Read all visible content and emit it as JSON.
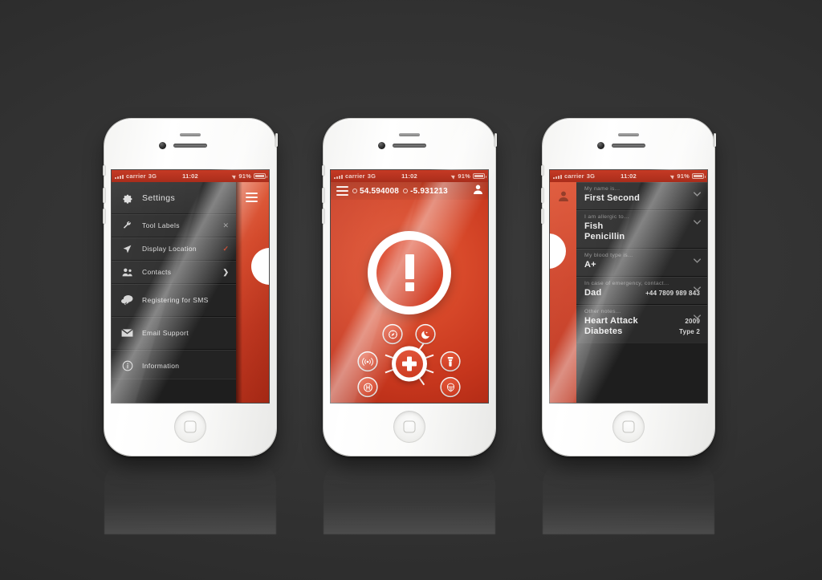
{
  "scene": {
    "background_color": "#2f2f2f",
    "device_count": 3,
    "device_color": "#ffffff",
    "accent_color": "#d3441f"
  },
  "status_bar": {
    "carrier_prefix": "..ıl",
    "carrier": "carrier",
    "network": "3G",
    "time": "11:02",
    "battery_percent": "91%",
    "signal_icon": "signal-bars-icon",
    "location_icon": "location-arrow-icon",
    "battery_icon": "battery-icon"
  },
  "phone1": {
    "name": "settings-menu-screen",
    "header": {
      "title": "Settings",
      "icon": "gear-icon"
    },
    "items": [
      {
        "label": "Tool Labels",
        "icon": "wrench-icon",
        "tail": "✕",
        "tail_name": "close-icon",
        "tail_color": "#8e8e8e"
      },
      {
        "label": "Display Location",
        "icon": "location-arrow-icon",
        "tail": "✓",
        "tail_name": "check-icon",
        "tail_color": "#c0391f"
      },
      {
        "label": "Contacts",
        "icon": "contacts-icon",
        "tail": "❯",
        "tail_name": "chevron-right-icon",
        "tail_color": "#d0d0d0"
      },
      {
        "label": "Registering for SMS",
        "icon": "chat-bubbles-icon",
        "tail": "",
        "tail_name": "",
        "tail_color": ""
      },
      {
        "label": "Email Support",
        "icon": "envelope-icon",
        "tail": "",
        "tail_name": "",
        "tail_color": ""
      },
      {
        "label": "Information",
        "icon": "info-circle-icon",
        "tail": "",
        "tail_name": "",
        "tail_color": ""
      }
    ],
    "panel": {
      "menu_icon": "hamburger-menu-icon"
    }
  },
  "phone2": {
    "name": "emergency-alert-screen",
    "toolbar": {
      "menu_icon": "hamburger-menu-icon",
      "latitude": "54.594008",
      "longitude": "-5.931213",
      "profile_icon": "person-icon"
    },
    "alert_button": {
      "label": "!",
      "icon": "exclamation-icon"
    },
    "center_button": {
      "icon": "plus-icon",
      "name": "add-tool-button"
    },
    "tools": [
      {
        "name": "compass-tool",
        "icon": "compass-icon"
      },
      {
        "name": "moon-tool",
        "icon": "moon-icon"
      },
      {
        "name": "flashlight-tool",
        "icon": "flashlight-icon"
      },
      {
        "name": "siren-tool",
        "icon": "siren-icon"
      },
      {
        "name": "hospital-tool",
        "icon": "hospital-h-icon"
      },
      {
        "name": "beacon-tool",
        "icon": "broadcast-signal-icon"
      }
    ]
  },
  "phone3": {
    "name": "medical-info-screen",
    "sidebar": {
      "profile_icon": "person-icon"
    },
    "cards": [
      {
        "caption": "My name is...",
        "lines": [
          {
            "value": "First Second",
            "sub": ""
          }
        ],
        "chevron": "chevron-down-icon"
      },
      {
        "caption": "I am allergic to...",
        "lines": [
          {
            "value": "Fish",
            "sub": ""
          },
          {
            "value": "Penicillin",
            "sub": ""
          }
        ],
        "chevron": "chevron-down-icon"
      },
      {
        "caption": "My blood type is...",
        "lines": [
          {
            "value": "A+",
            "sub": ""
          }
        ],
        "chevron": "chevron-down-icon"
      },
      {
        "caption": "In case of emergency, contact...",
        "lines": [
          {
            "value": "Dad",
            "sub": "+44 7809 989 843"
          }
        ],
        "chevron": "chevron-down-icon"
      },
      {
        "caption": "Other notes...",
        "lines": [
          {
            "value": "Heart Attack",
            "sub": "2009"
          },
          {
            "value": "Diabetes",
            "sub": "Type 2"
          }
        ],
        "chevron": "chevron-down-icon"
      }
    ]
  }
}
